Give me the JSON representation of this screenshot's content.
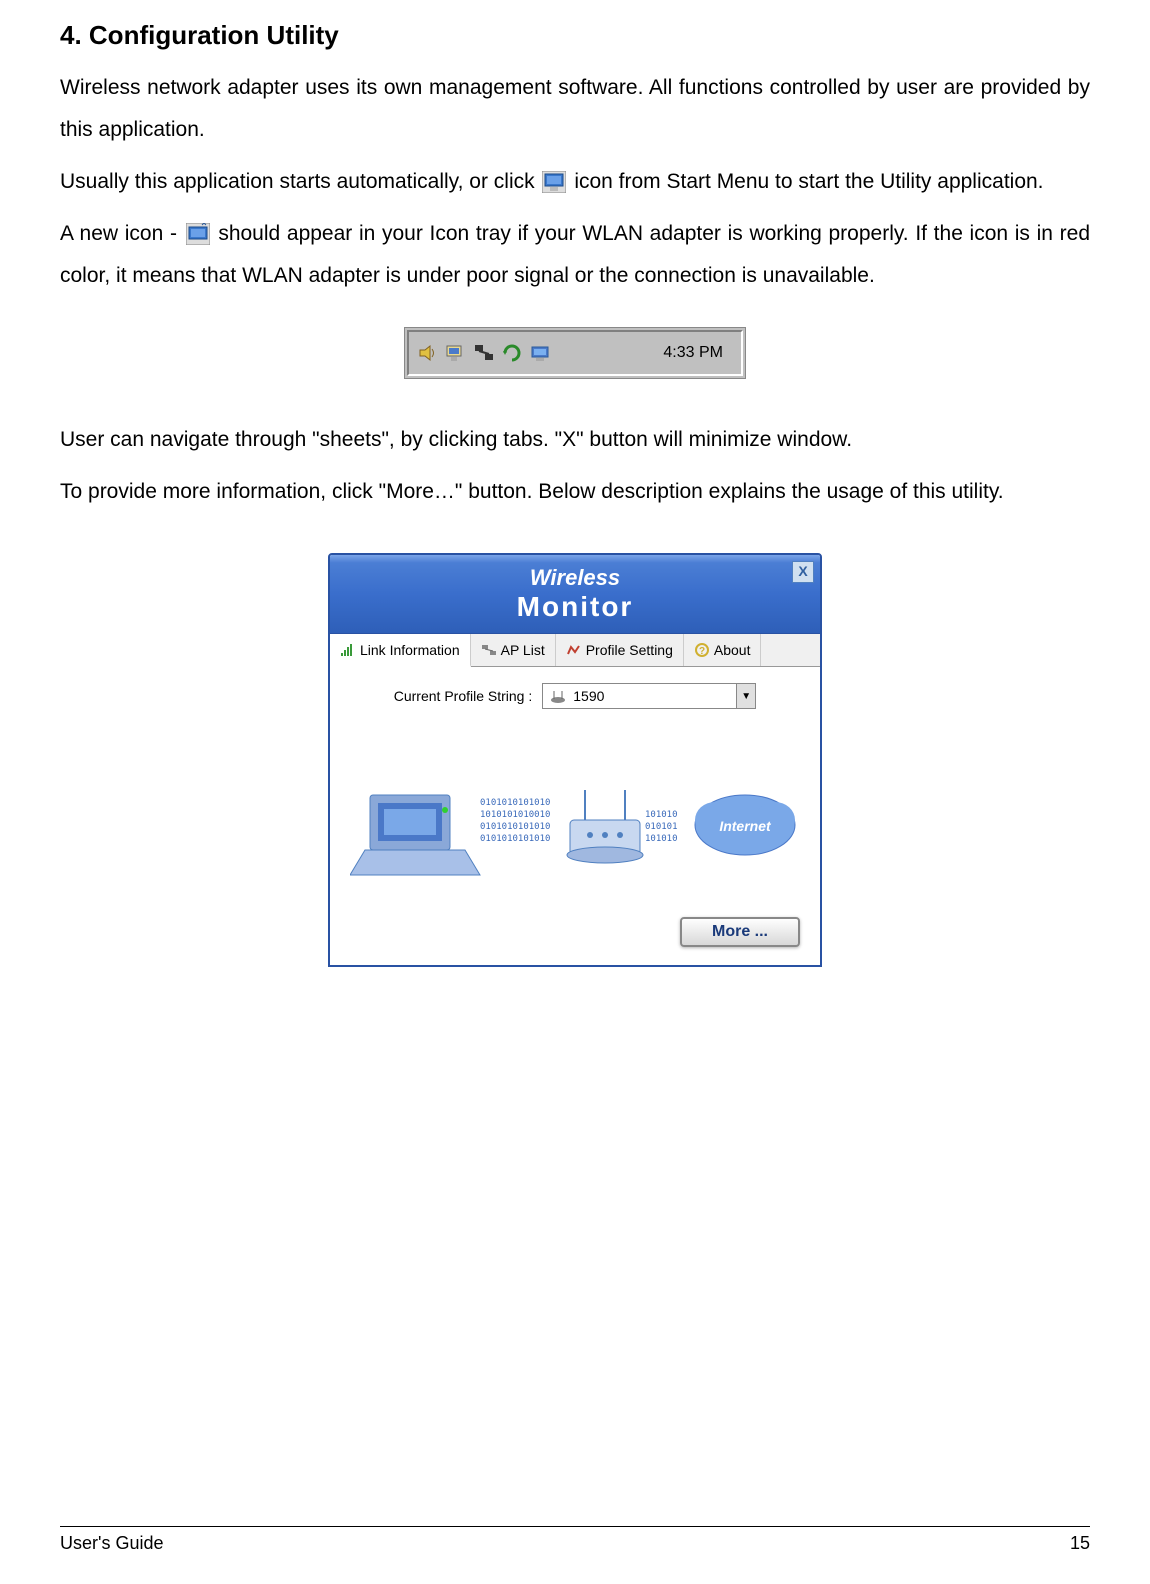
{
  "heading": "4. Configuration Utility",
  "para1": "Wireless network adapter uses its own management software. All functions controlled by user are provided by this application.",
  "para2a": "Usually this application starts automatically, or click ",
  "para2b": " icon from Start Menu to start the Utility application.",
  "para3a": "A new icon - ",
  "para3b": " should appear in your Icon tray if your WLAN adapter is working properly. If the icon is in red color, it means that WLAN adapter is under poor signal or the connection is unavailable.",
  "para4": "User can navigate through \"sheets\", by clicking tabs.  \"X\" button will minimize window.",
  "para5": "To provide more information, click \"More…\" button. Below description explains the usage of this utility.",
  "tray": {
    "time": "4:33 PM"
  },
  "window": {
    "title_top": "Wireless",
    "title_sub": "Monitor",
    "close": "X",
    "tabs": {
      "link": "Link Information",
      "ap": "AP List",
      "profile": "Profile Setting",
      "about": "About"
    },
    "profile_label": "Current Profile String :",
    "profile_value": "1590",
    "internet_label": "Internet",
    "more_button": "More ..."
  },
  "footer": {
    "guide": "User's Guide",
    "page": "15"
  }
}
